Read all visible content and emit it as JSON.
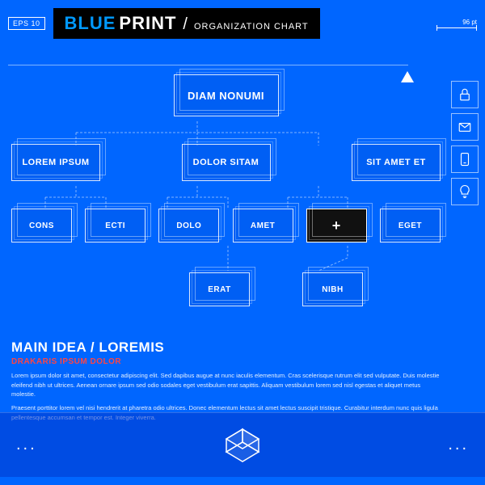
{
  "header": {
    "eps_label": "EPS 10",
    "title_blue": "BLUE",
    "title_white": "PRINT",
    "slash": "/",
    "subtitle": "ORGANIZATION CHART",
    "dim_label": "96 pt"
  },
  "sidebar": {
    "icons": [
      "lock",
      "mail",
      "phone",
      "bulb"
    ]
  },
  "org_chart": {
    "row0": [
      {
        "label": "DIAM NONUMI"
      }
    ],
    "row1": [
      {
        "label": "LOREM IPSUM"
      },
      {
        "label": "DOLOR SITAM"
      },
      {
        "label": "SIT AMET ET"
      }
    ],
    "row2": [
      {
        "label": "CONS"
      },
      {
        "label": "ECTI"
      },
      {
        "label": "DOLO"
      },
      {
        "label": "AMET"
      },
      {
        "label": "+",
        "dark": true
      },
      {
        "label": "EGET"
      }
    ],
    "row3": [
      {
        "label": "ERAT"
      },
      {
        "label": "NIBH"
      }
    ]
  },
  "main_idea": {
    "title": "MAIN IDEA / LOREMIS",
    "subtitle": "DRAKARIS IPSUM DOLOR",
    "paragraphs": [
      "Lorem ipsum dolor sit amet, consectetur adipiscing elit. Sed dapibus augue at nunc iaculis elementum. Cras scelerisque rutrum elit sed vulputate. Duis molestie eleifend nibh ut ultrices. Aenean ornare ipsum sed odio sodales eget vestibulum erat sapittis. Aliquam vestibulum lorem sed nisl egestas et aliquet metus molestie.",
      "Praesent porttitor lorem vel nisi hendrerit at pharetra odio ultrices. Donec elementum lectus sit amet lectus suscipit tristique. Curabitur interdum nunc quis ligula pellentesque accumsan et tempor est. Integer viverra."
    ]
  },
  "footer": {
    "left_dots": "...",
    "right_dots": "..."
  }
}
